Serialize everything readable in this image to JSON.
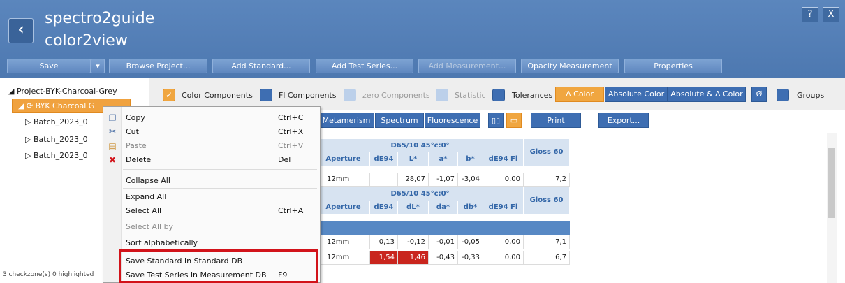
{
  "app": {
    "title_line1": "spectro2guide",
    "title_line2": "color2view",
    "back_icon": "back-arrow-icon",
    "help_label": "?",
    "close_label": "X"
  },
  "toolbar": {
    "save": "Save",
    "browse_project": "Browse Project...",
    "add_standard": "Add Standard...",
    "add_test_series": "Add Test Series...",
    "add_measurement": "Add Measurement...",
    "opacity_measurement": "Opacity Measurement",
    "properties": "Properties"
  },
  "tree": {
    "project": "Project-BYK-Charcoal-Grey",
    "standard": "BYK Charcoal G",
    "batches": [
      "Batch_2023_0",
      "Batch_2023_0",
      "Batch_2023_0"
    ],
    "status": "3 checkzone(s) 0 highlighted"
  },
  "options": {
    "color_components": "Color Components",
    "fl_components": "Fl Components",
    "zero_components": "zero Components",
    "statistic": "Statistic",
    "tolerances": "Tolerances",
    "delta_color": "Δ Color",
    "absolute_color": "Absolute Color",
    "absolute_delta_color": "Absolute & Δ Color",
    "empty_set": "Ø",
    "groups": "Groups"
  },
  "subtoolbar": {
    "metamerism": "Metamerism",
    "spectrum": "Spectrum",
    "fluorescence": "Fluorescence",
    "print": "Print",
    "export": "Export..."
  },
  "table": {
    "illum": "D65/10 45°c:0°",
    "gloss": "Gloss 60",
    "abs_headers": [
      "Aperture",
      "dE94",
      "L*",
      "a*",
      "b*",
      "dE94 Fl"
    ],
    "delta_headers": [
      "Aperture",
      "dE94",
      "dL*",
      "da*",
      "db*",
      "dE94 Fl"
    ],
    "abs_row": [
      "12mm",
      "",
      "28,07",
      "-1,07",
      "-3,04",
      "0,00",
      "7,2"
    ],
    "rows": [
      [
        "12mm",
        "0,13",
        "-0,12",
        "-0,01",
        "-0,05",
        "0,00",
        "7,1"
      ],
      [
        "12mm",
        "1,54",
        "1,46",
        "-0,43",
        "-0,33",
        "0,00",
        "6,7"
      ]
    ],
    "highlight_color": "#c9251e"
  },
  "context_menu": {
    "copy": "Copy",
    "copy_sc": "Ctrl+C",
    "cut": "Cut",
    "cut_sc": "Ctrl+X",
    "paste": "Paste",
    "paste_sc": "Ctrl+V",
    "delete": "Delete",
    "delete_sc": "Del",
    "collapse_all": "Collapse All",
    "expand_all": "Expand All",
    "select_all": "Select All",
    "select_all_sc": "Ctrl+A",
    "select_all_by": "Select All by",
    "sort_alpha": "Sort alphabetically",
    "save_standard": "Save Standard in Standard DB",
    "save_test_series": "Save Test Series in Measurement DB",
    "save_test_series_sc": "F9"
  }
}
